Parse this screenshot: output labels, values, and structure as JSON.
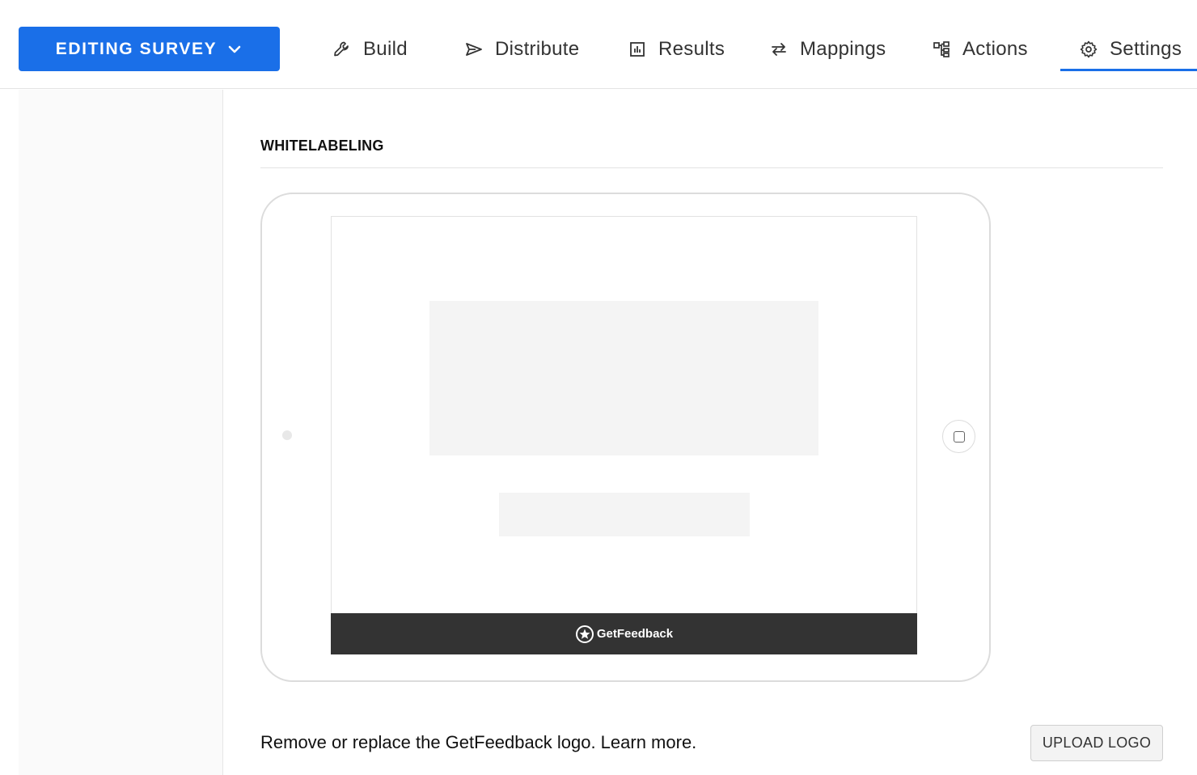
{
  "header": {
    "mode_button": "EDITING SURVEY",
    "tabs": [
      {
        "label": "Build",
        "icon": "wrench-icon"
      },
      {
        "label": "Distribute",
        "icon": "send-icon"
      },
      {
        "label": "Results",
        "icon": "bar-chart-icon"
      },
      {
        "label": "Mappings",
        "icon": "swap-arrows-icon"
      },
      {
        "label": "Actions",
        "icon": "flow-icon"
      },
      {
        "label": "Settings",
        "icon": "gear-icon"
      }
    ],
    "active_tab": "Settings"
  },
  "main": {
    "section_title": "WHITELABELING",
    "preview": {
      "brand_text": "GetFeedback"
    },
    "description": "Remove or replace the GetFeedback logo. Learn more.",
    "upload_button": "UPLOAD LOGO"
  },
  "colors": {
    "accent": "#1a6fe8",
    "footer_bar": "#333333",
    "placeholder": "#f4f4f4"
  }
}
